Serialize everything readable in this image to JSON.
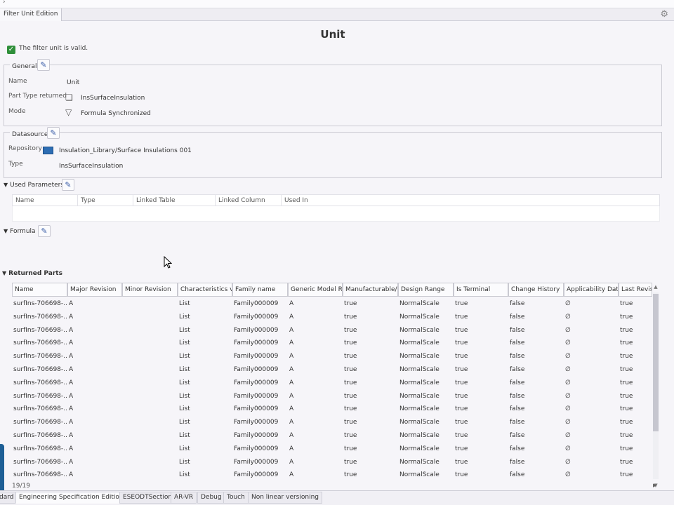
{
  "view": {
    "tab_label": "Filter Unit Edition",
    "gear_icon": "gear-icon"
  },
  "title": "Unit",
  "status": {
    "valid_text": "The filter unit is valid."
  },
  "general": {
    "legend": "General",
    "name_label": "Name",
    "name_value": "Unit",
    "part_type_label": "Part Type returned",
    "part_type_value": "InsSurfaceInsulation",
    "mode_label": "Mode",
    "mode_value": "Formula Synchronized"
  },
  "datasource": {
    "legend": "Datasource",
    "repository_label": "Repository",
    "repository_value": "Insulation_Library/Surface Insulations 001",
    "type_label": "Type",
    "type_value": "InsSurfaceInsulation"
  },
  "used_parameters": {
    "label": "Used Parameters",
    "columns": [
      "Name",
      "Type",
      "Linked Table",
      "Linked Column",
      "Used In"
    ]
  },
  "formula": {
    "label": "Formula"
  },
  "returned_parts": {
    "label": "Returned Parts",
    "columns": [
      "Name",
      "Major Revision",
      "Minor Revision",
      "Characteristics val",
      "Family name",
      "Generic Model Re",
      "Manufacturable/F",
      "Design Range",
      "Is Terminal",
      "Change History",
      "Applicability Date",
      "Last Revis"
    ],
    "rows": [
      [
        "surfIns-706698-...",
        "A",
        "",
        "List",
        "Family000009",
        "A",
        "true",
        "NormalScale",
        "true",
        "false",
        "∅",
        "true"
      ],
      [
        "surfIns-706698-...",
        "A",
        "",
        "List",
        "Family000009",
        "A",
        "true",
        "NormalScale",
        "true",
        "false",
        "∅",
        "true"
      ],
      [
        "surfIns-706698-...",
        "A",
        "",
        "List",
        "Family000009",
        "A",
        "true",
        "NormalScale",
        "true",
        "false",
        "∅",
        "true"
      ],
      [
        "surfIns-706698-...",
        "A",
        "",
        "List",
        "Family000009",
        "A",
        "true",
        "NormalScale",
        "true",
        "false",
        "∅",
        "true"
      ],
      [
        "surfIns-706698-...",
        "A",
        "",
        "List",
        "Family000009",
        "A",
        "true",
        "NormalScale",
        "true",
        "false",
        "∅",
        "true"
      ],
      [
        "surfIns-706698-...",
        "A",
        "",
        "List",
        "Family000009",
        "A",
        "true",
        "NormalScale",
        "true",
        "false",
        "∅",
        "true"
      ],
      [
        "surfIns-706698-...",
        "A",
        "",
        "List",
        "Family000009",
        "A",
        "true",
        "NormalScale",
        "true",
        "false",
        "∅",
        "true"
      ],
      [
        "surfIns-706698-...",
        "A",
        "",
        "List",
        "Family000009",
        "A",
        "true",
        "NormalScale",
        "true",
        "false",
        "∅",
        "true"
      ],
      [
        "surfIns-706698-...",
        "A",
        "",
        "List",
        "Family000009",
        "A",
        "true",
        "NormalScale",
        "true",
        "false",
        "∅",
        "true"
      ],
      [
        "surfIns-706698-...",
        "A",
        "",
        "List",
        "Family000009",
        "A",
        "true",
        "NormalScale",
        "true",
        "false",
        "∅",
        "true"
      ],
      [
        "surfIns-706698-...",
        "A",
        "",
        "List",
        "Family000009",
        "A",
        "true",
        "NormalScale",
        "true",
        "false",
        "∅",
        "true"
      ],
      [
        "surfIns-706698-...",
        "A",
        "",
        "List",
        "Family000009",
        "A",
        "true",
        "NormalScale",
        "true",
        "false",
        "∅",
        "true"
      ],
      [
        "surfIns-706698-...",
        "A",
        "",
        "List",
        "Family000009",
        "A",
        "true",
        "NormalScale",
        "true",
        "false",
        "∅",
        "true"
      ],
      [
        "surfIns-706698-...",
        "A",
        "",
        "List",
        "Family000009",
        "A",
        "true",
        "NormalScale",
        "true",
        "false",
        "∅",
        "true"
      ]
    ],
    "count": "19/19"
  },
  "bottom_tabs": [
    "dard",
    "Engineering Specification Edition",
    "ESEODTSection",
    "AR-VR",
    "Debug",
    "Touch",
    "Non linear versioning"
  ],
  "active_bottom_tab": "Engineering Specification Edition"
}
